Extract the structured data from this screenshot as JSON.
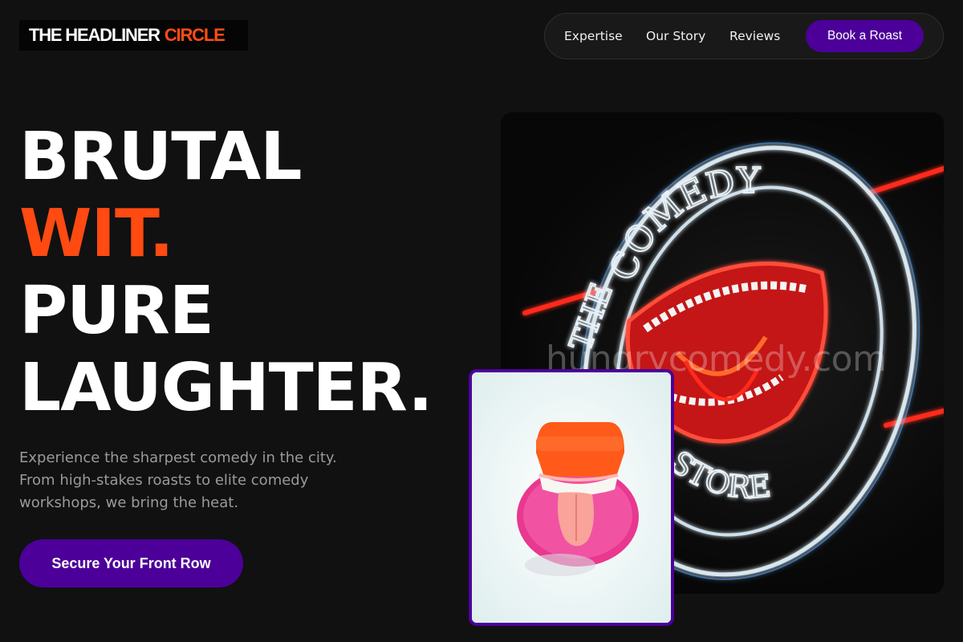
{
  "brand": {
    "name_part1": "THE HEADLINER",
    "name_part2": "CIRCLE",
    "accent_color": "#ff4d12",
    "primary_color": "#4c0099"
  },
  "nav": {
    "items": [
      {
        "label": "Expertise"
      },
      {
        "label": "Our Story"
      },
      {
        "label": "Reviews"
      }
    ],
    "cta_label": "Book a Roast"
  },
  "hero": {
    "line1": "BRUTAL",
    "line2": "WIT.",
    "line3": "PURE",
    "line4": "LAUGHTER.",
    "subtext": "Experience the sharpest comedy in the city. From high-stakes roasts to elite comedy workshops, we bring the heat.",
    "cta_label": "Secure Your Front Row"
  },
  "images": {
    "neon_sign": {
      "sign_text_top": "COMEDY",
      "sign_text_left": "THE",
      "sign_text_bottom": "STORE",
      "watermark": "hungrycomedy.com",
      "icon": "neon-mouth-sign"
    },
    "photo": {
      "icon": "wind-up-teeth-photo"
    }
  }
}
